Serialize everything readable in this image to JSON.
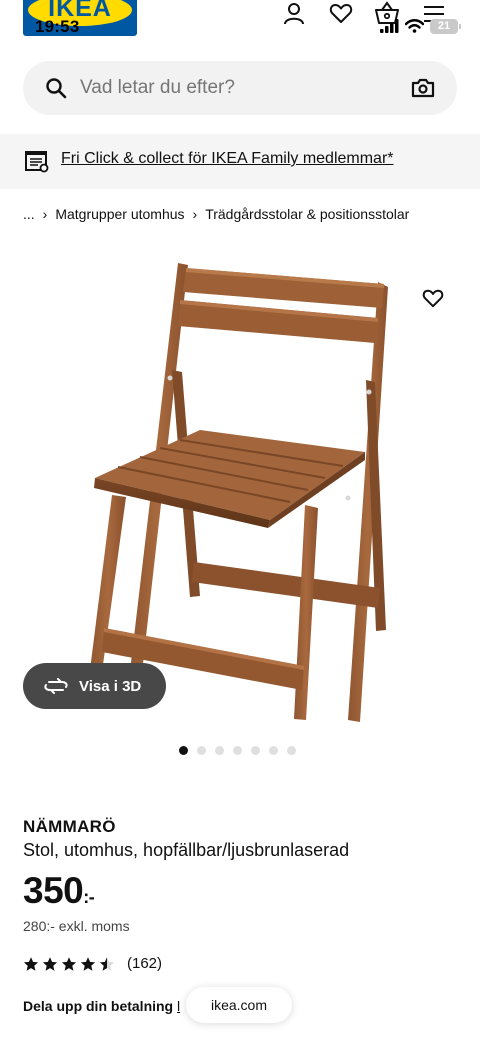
{
  "status_bar": {
    "time": "19:53",
    "battery": "21"
  },
  "header": {
    "logo_text": "IKEA",
    "icons": [
      "user-icon",
      "heart-icon",
      "basket-icon",
      "menu-icon"
    ]
  },
  "search": {
    "placeholder": "Vad letar du efter?"
  },
  "promo": {
    "text": "Fri Click & collect för IKEA Family medlemmar*"
  },
  "breadcrumb": {
    "ellipsis": "...",
    "items": [
      "Matgrupper utomhus",
      "Trädgårdsstolar & positionsstolar"
    ]
  },
  "gallery": {
    "view_3d_label": "Visa i 3D",
    "slide_count": 7,
    "active_index": 0
  },
  "product": {
    "name": "NÄMMARÖ",
    "description": "Stol, utomhus, hopfällbar/ljusbrunlaserad",
    "price": "350",
    "price_suffix": ":-",
    "price_excl_vat": "280:- exkl. moms",
    "rating_value": 4.5,
    "rating_max": 5,
    "rating_count": "(162)",
    "installment_text": "Dela upp din betalning",
    "installment_link": "l"
  },
  "browser": {
    "domain": "ikea.com"
  },
  "colors": {
    "ikea_blue": "#0058a3",
    "ikea_yellow": "#ffdb00",
    "chair_wood": "#9b5e35"
  }
}
